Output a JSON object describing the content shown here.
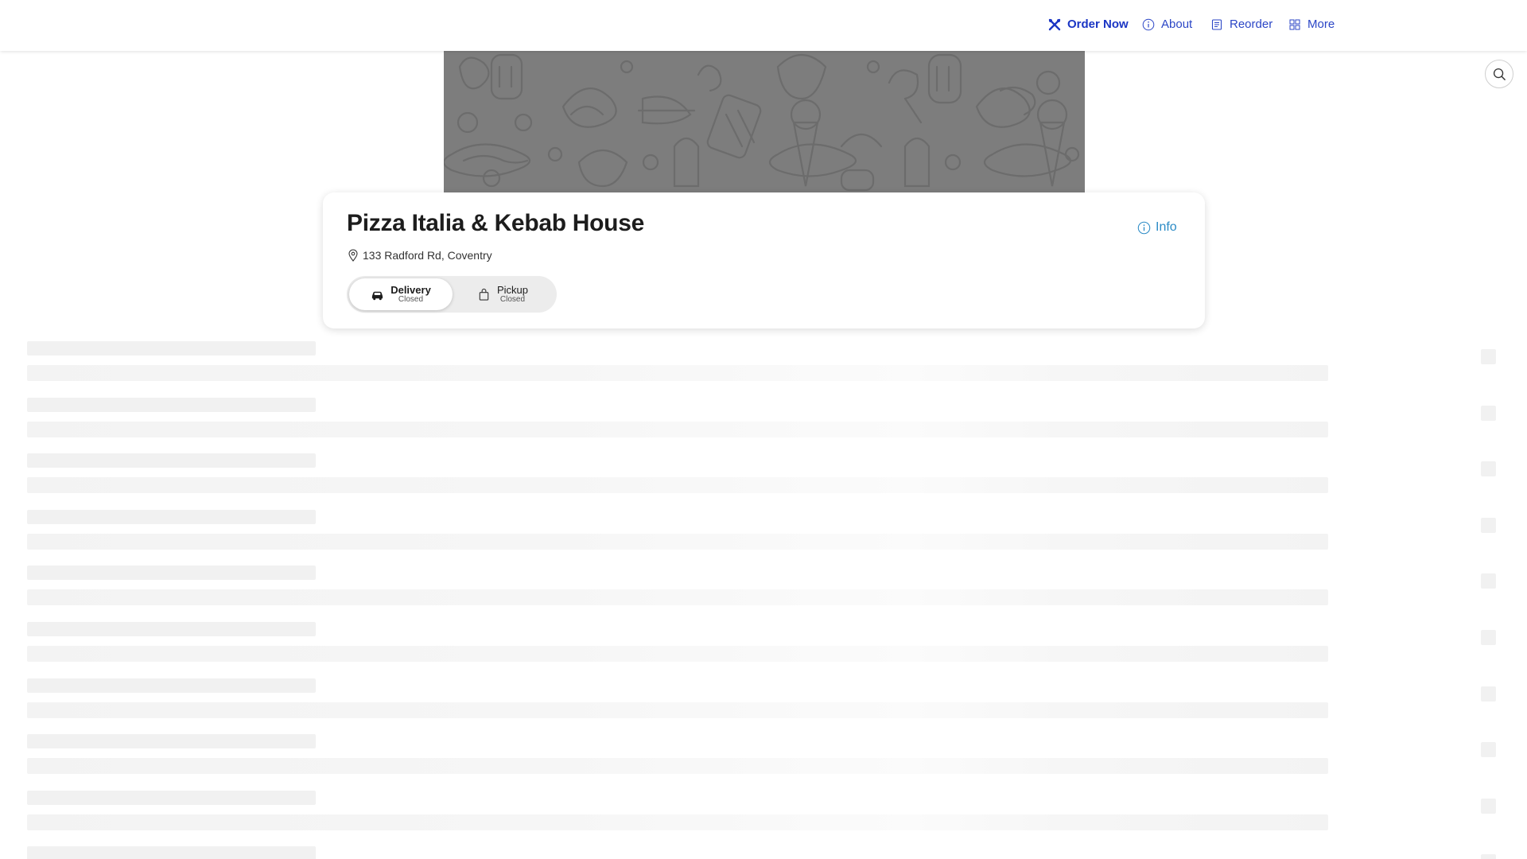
{
  "nav": {
    "order_now": "Order Now",
    "about": "About",
    "reorder": "Reorder",
    "more": "More",
    "icons": [
      "utensils-icon",
      "info-icon",
      "receipt-icon",
      "grid-icon"
    ]
  },
  "restaurant": {
    "name": "Pizza Italia & Kebab House",
    "address": "133 Radford Rd, Coventry",
    "info_label": "Info"
  },
  "fulfillment": {
    "selected": "delivery",
    "delivery_label": "Delivery",
    "delivery_status": "Closed",
    "pickup_label": "Pickup",
    "pickup_status": "Closed"
  },
  "colors": {
    "nav_link": "#2b46c6",
    "info_link": "#2b8bc6",
    "banner": "#7d7d7d"
  },
  "skeleton_rows": 10
}
